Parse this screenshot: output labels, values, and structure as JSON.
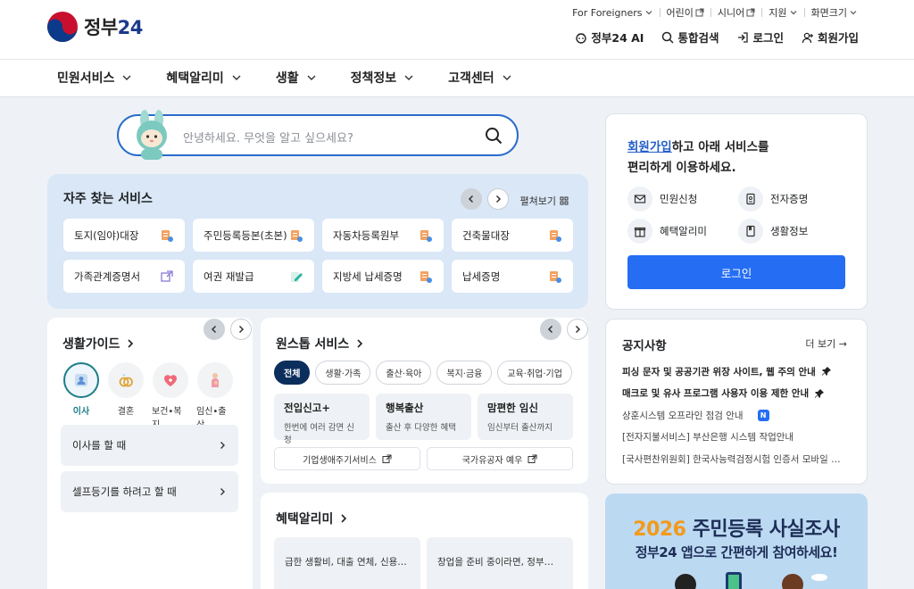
{
  "header": {
    "logo_text": "정부",
    "logo_num": "24",
    "util": [
      "For Foreigners",
      "어린이",
      "시니어",
      "지원",
      "화면크기"
    ],
    "quick": [
      "정부24 AI",
      "통합검색",
      "로그인",
      "회원가입"
    ]
  },
  "nav": [
    "민원서비스",
    "혜택알리미",
    "생활",
    "정책정보",
    "고객센터"
  ],
  "search": {
    "placeholder": "안녕하세요. 무엇을 알고 싶으세요?"
  },
  "frequent": {
    "title": "자주 찾는 서비스",
    "expand": "펼쳐보기",
    "items": [
      "토지(임야)대장",
      "주민등록등본(초본)",
      "자동차등록원부",
      "건축물대장",
      "가족관계증명서",
      "여권 재발급",
      "지방세 납세증명",
      "납세증명"
    ]
  },
  "login_panel": {
    "title_link": "회원가입",
    "title_rest1": "하고 아래 서비스를",
    "title_rest2": "편리하게 이용하세요.",
    "items": [
      "민원신청",
      "전자증명",
      "혜택알리미",
      "생활정보"
    ],
    "button": "로그인"
  },
  "life_guide": {
    "title": "생활가이드",
    "icons": [
      "이사",
      "결혼",
      "보건•복지",
      "임신•출산"
    ],
    "rows": [
      "이사를 할 때",
      "셀프등기를 하려고 할 때"
    ]
  },
  "onestop": {
    "title": "원스톱 서비스",
    "chips": [
      "전체",
      "생활·가족",
      "출산·육아",
      "복지·금융",
      "교육·취업·기업"
    ],
    "cards": [
      {
        "title": "전입신고+",
        "desc": "한번에 여러 감면 신청"
      },
      {
        "title": "행복출산",
        "desc": "출산 후 다양한 혜택"
      },
      {
        "title": "맘편한 임신",
        "desc": "임신부터 출산까지"
      }
    ],
    "links": [
      "기업생애주기서비스",
      "국가유공자 예우"
    ]
  },
  "benefit": {
    "title": "혜택알리미",
    "cards": [
      "급한 생활비, 대출 연체, 신용…",
      "창업을 준비 중이라면, 정부…"
    ]
  },
  "notice": {
    "title": "공지사항",
    "more": "더 보기 →",
    "items": [
      {
        "text": "피싱 문자 및 공공기관 위장 사이트, 웹 주의 안내",
        "bold": true,
        "pin": true
      },
      {
        "text": "매크로 및 유사 프로그램 사용자 이용 제한 안내",
        "bold": true,
        "pin": true
      },
      {
        "text": "상훈시스템 오프라인 점검 안내",
        "badge": "N"
      },
      {
        "text": "[전자지불서비스] 부산은행 시스템 작업안내"
      },
      {
        "text": "[국사편찬위원회] 한국사능력검정시험 인증서 모바일 …"
      }
    ]
  },
  "banner": {
    "year": "2026",
    "title_rest": " 주민등록 사실조사",
    "sub": "정부24 앱으로 간편하게 참여하세요!"
  },
  "colors": {
    "primary": "#256ef4",
    "freq_bg": "#d9e7f7",
    "chip_active": "#0b2e5c",
    "banner_bg": "#bcd9f2"
  }
}
